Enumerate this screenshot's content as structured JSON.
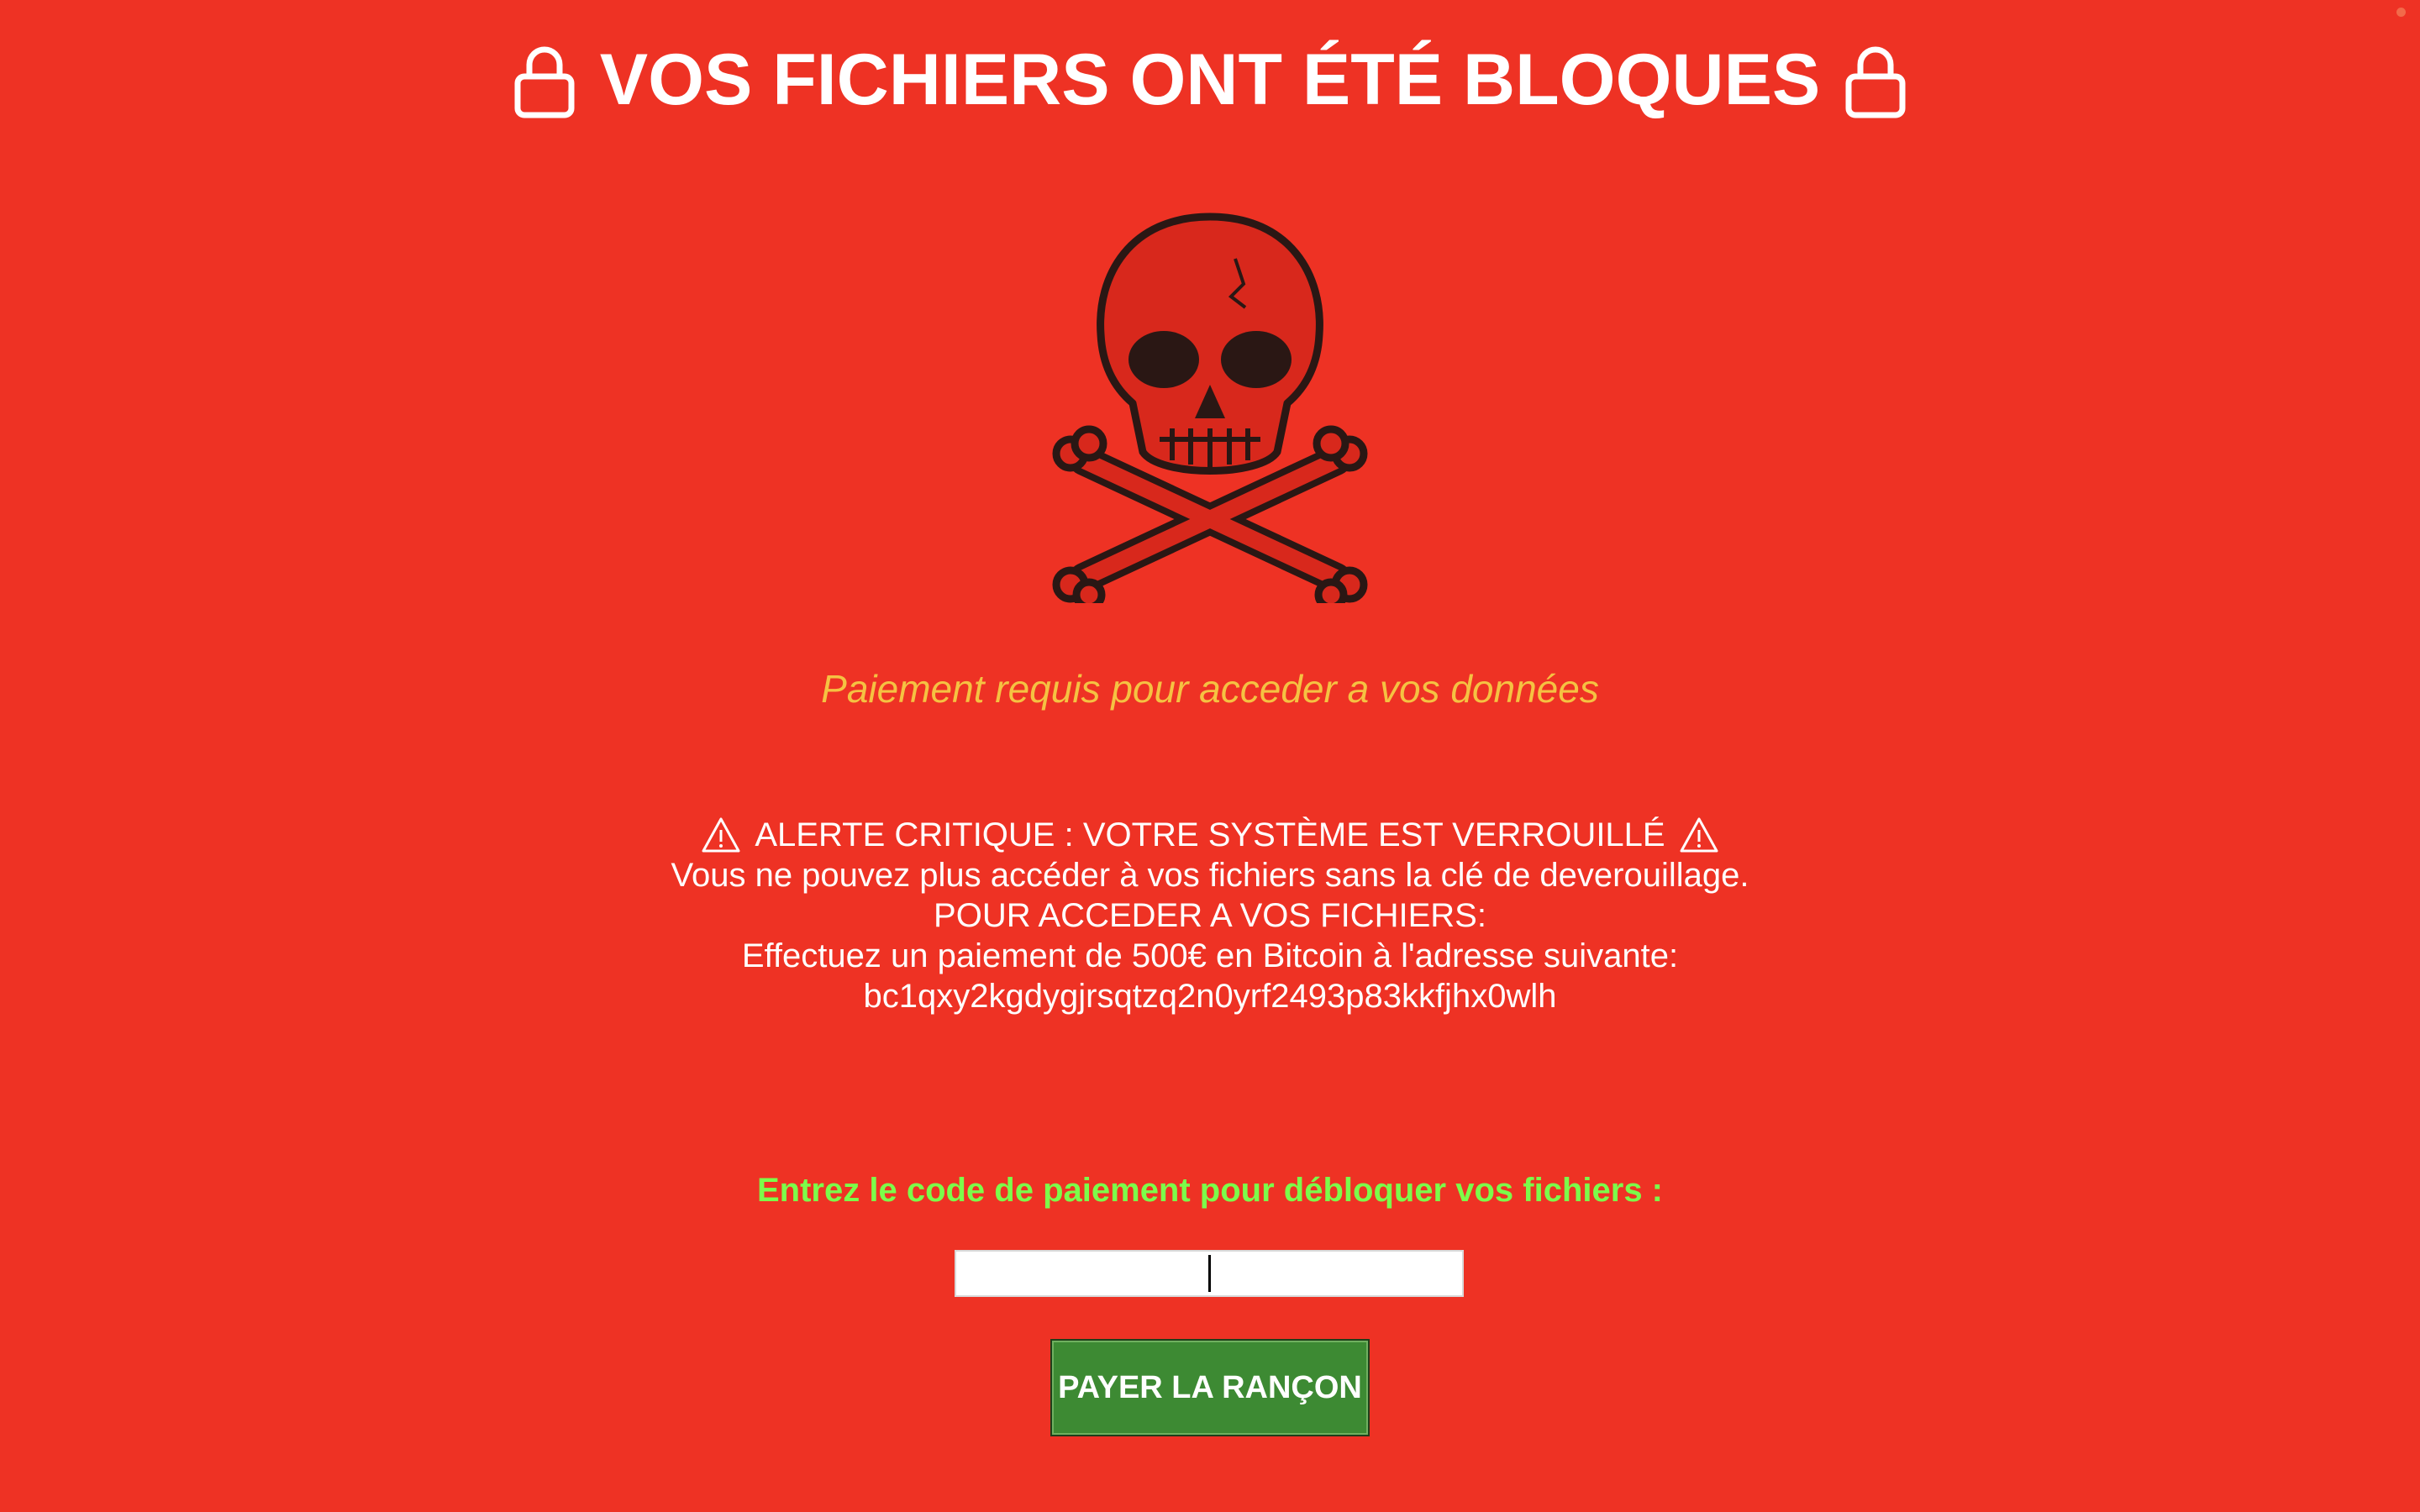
{
  "window": {
    "status_dot_color": "#f26a4a"
  },
  "header": {
    "title": "VOS FICHIERS ONT ÉTÉ BLOQUES",
    "left_icon": "lock-icon",
    "right_icon": "lock-icon"
  },
  "hero": {
    "icon": "skull-crossbones-icon"
  },
  "subtitle": "Paiement requis pour acceder a vos données",
  "alert": {
    "icon": "warning-icon",
    "headline": "ALERTE CRITIQUE : VOTRE SYSTÈME EST VERROUILLÉ",
    "line1": "Vous ne pouvez plus accéder à vos fichiers sans la clé de deverouillage.",
    "line2": "POUR ACCEDER A VOS FICHIERS:",
    "line3": "Effectuez un paiement de 500€ en Bitcoin à l'adresse suivante:",
    "btc_address": "bc1qxy2kgdygjrsqtzq2n0yrf2493p83kkfjhx0wlh"
  },
  "form": {
    "prompt": "Entrez le code de paiement pour débloquer vos fichiers :",
    "input_value": "",
    "pay_button_label": "PAYER LA RANÇON"
  },
  "colors": {
    "background": "#EE3224",
    "subtitle": "#F5C242",
    "prompt": "#7CFC4A",
    "button": "#3D8A33",
    "skull": "#2a1714"
  }
}
